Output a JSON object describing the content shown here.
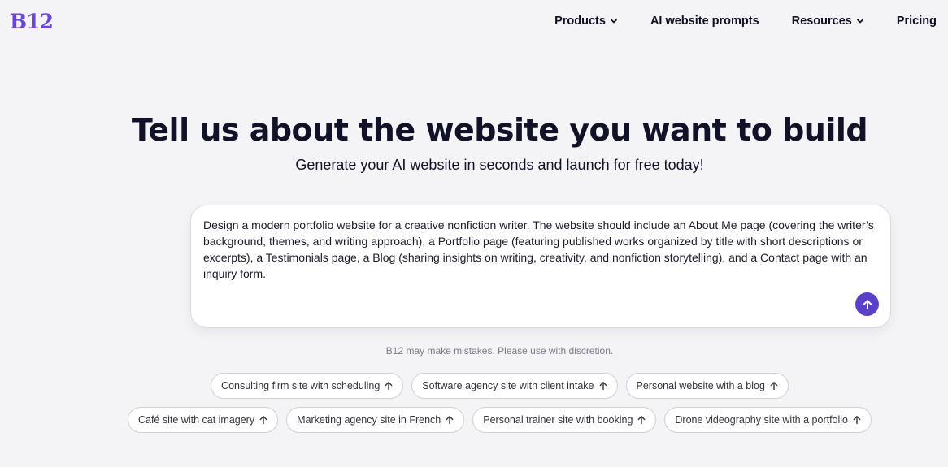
{
  "header": {
    "logo": "B12",
    "nav": [
      {
        "label": "Products",
        "has_dropdown": true
      },
      {
        "label": "AI website prompts",
        "has_dropdown": false
      },
      {
        "label": "Resources",
        "has_dropdown": true
      },
      {
        "label": "Pricing",
        "has_dropdown": false
      }
    ]
  },
  "hero": {
    "title": "Tell us about the website you want to build",
    "subtitle": "Generate your AI website in seconds and launch for free today!"
  },
  "prompt": {
    "value": "Design a modern portfolio website for a creative nonfiction writer. The website should include an About Me page (covering the writer’s background, themes, and writing approach), a Portfolio page (featuring published works organized by title with short descriptions or excerpts), a Testimonials page, a Blog (sharing insights on writing, creativity, and nonfiction storytelling), and a Contact page with an inquiry form.",
    "send_icon": "arrow-up-icon"
  },
  "disclaimer": "B12 may make mistakes. Please use with discretion.",
  "suggestions": {
    "row1": [
      {
        "label": "Consulting firm site with scheduling"
      },
      {
        "label": "Software agency site with client intake"
      },
      {
        "label": "Personal website with a blog"
      }
    ],
    "row2": [
      {
        "label": "Café site with cat imagery"
      },
      {
        "label": "Marketing agency site in French"
      },
      {
        "label": "Personal trainer site with booking"
      },
      {
        "label": "Drone videography site with a portfolio"
      }
    ]
  },
  "colors": {
    "brand": "#6b46d6",
    "send_button": "#5a3fc8",
    "background": "#f4f4f6",
    "text": "#111227"
  }
}
